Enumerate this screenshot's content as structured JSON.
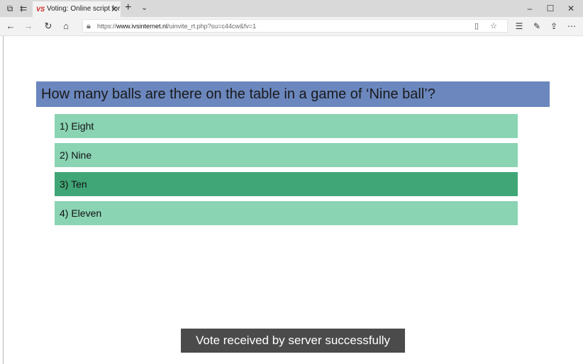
{
  "browser": {
    "tab": {
      "favicon_text": "VS",
      "title": "Voting: Online script for",
      "close_glyph": "✕"
    },
    "new_tab_glyph": "+",
    "tab_menu_glyph": "⌄",
    "window_controls": {
      "minimize": "–",
      "maximize": "☐",
      "close": "✕"
    },
    "url": {
      "prefix": "https://",
      "host": "www.ivsinternet.nl",
      "path": "/uinvite_rt.php?su=c44cw&fv=1"
    }
  },
  "question": {
    "text": "How many balls are there on the table in a game of ‘Nine ball’?"
  },
  "answers": [
    {
      "label": "1)  Eight",
      "selected": false
    },
    {
      "label": "2)  Nine",
      "selected": false
    },
    {
      "label": "3)  Ten",
      "selected": true
    },
    {
      "label": "4)  Eleven",
      "selected": false
    }
  ],
  "toast": {
    "message": "Vote received by server successfully"
  },
  "colors": {
    "question_bg": "#6b87be",
    "answer_bg": "#8ad3b3",
    "answer_selected_bg": "#41a677",
    "toast_bg": "#4b4b4b"
  },
  "icons": [
    "tab-actions-icon",
    "set-aside-tabs-icon",
    "back-icon",
    "forward-icon",
    "refresh-icon",
    "home-icon",
    "lock-icon",
    "reading-view-icon",
    "favorite-star-icon",
    "favorites-icon",
    "notes-icon",
    "share-icon",
    "more-icon"
  ]
}
